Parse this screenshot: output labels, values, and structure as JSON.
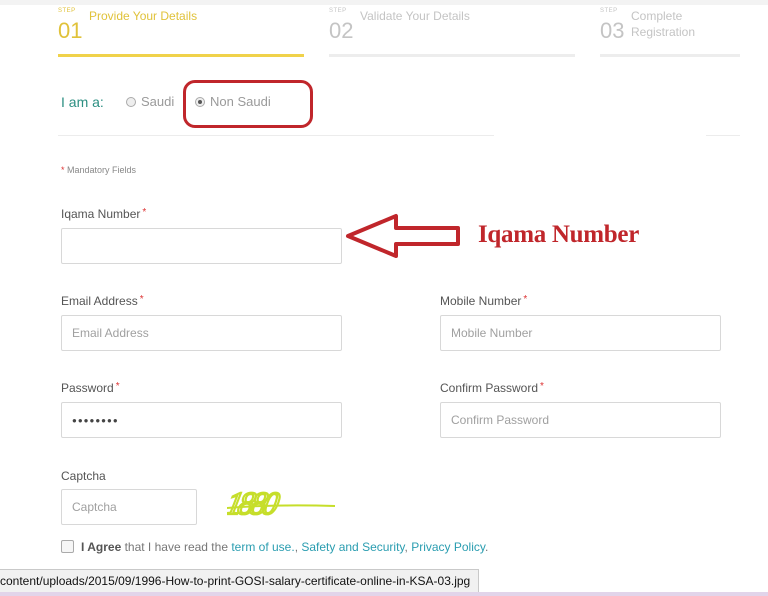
{
  "steps": [
    {
      "tiny": "STEP",
      "number": "01",
      "title": "Provide Your Details",
      "active": true
    },
    {
      "tiny": "STEP",
      "number": "02",
      "title": "Validate Your Details",
      "active": false
    },
    {
      "tiny": "STEP",
      "number": "03",
      "title": "Complete Registration",
      "active": false
    }
  ],
  "nationality": {
    "label": "I am a:",
    "options": [
      {
        "label": "Saudi",
        "selected": false
      },
      {
        "label": "Non Saudi",
        "selected": true
      }
    ]
  },
  "mandatory": {
    "asterisk": "*",
    "text": "Mandatory Fields"
  },
  "fields": {
    "iqama": {
      "label": "Iqama Number",
      "required": "*",
      "value": "",
      "placeholder": ""
    },
    "email": {
      "label": "Email Address",
      "required": "*",
      "value": "",
      "placeholder": "Email Address"
    },
    "mobile": {
      "label": "Mobile Number",
      "required": "*",
      "value": "",
      "placeholder": "Mobile Number"
    },
    "password": {
      "label": "Password",
      "required": "*",
      "value": "●●●●●●●●",
      "placeholder": ""
    },
    "confirm_password": {
      "label": "Confirm Password",
      "required": "*",
      "value": "",
      "placeholder": "Confirm Password"
    },
    "captcha": {
      "label": "Captcha",
      "value": "",
      "placeholder": "Captcha",
      "image_text": "1880"
    }
  },
  "annotation": {
    "text": "Iqama Number",
    "color": "#c0262b"
  },
  "agree": {
    "strong": "I Agree",
    "text": " that I have read the ",
    "link1": "term of use.",
    "sep1": ", ",
    "link2": "Safety and Security",
    "sep2": ", ",
    "link3": "Privacy Policy",
    "end": "."
  },
  "status_url": "content/uploads/2015/09/1996-How-to-print-GOSI-salary-certificate-online-in-KSA-03.jpg",
  "colors": {
    "accent": "#f0d24a",
    "teal": "#2c8f82",
    "link": "#2a9db0",
    "required": "#dd3333"
  }
}
